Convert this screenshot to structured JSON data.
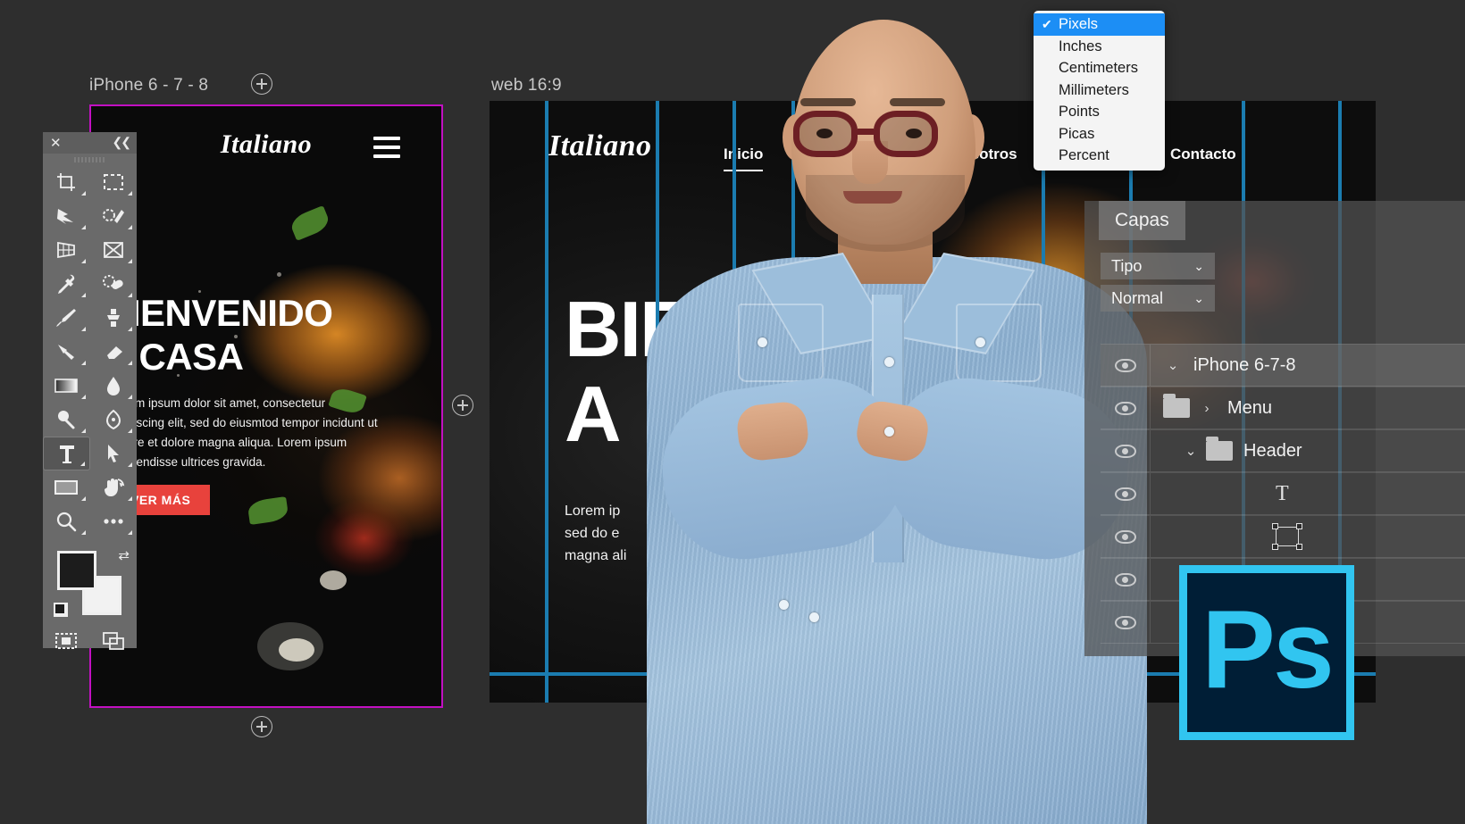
{
  "app": {
    "name": "Adobe Photoshop",
    "logo_text": "Ps",
    "accent_cyan": "#31C5F0",
    "logo_bg": "#001E36"
  },
  "canvas": {
    "background_color": "#2E2E2E",
    "artboards": [
      {
        "label": "iPhone 6 - 7 - 8",
        "border_color": "#C210C2",
        "design": {
          "logo": "Italiano",
          "menu_icon": "hamburger-icon",
          "heading_line1": "BIENVENIDO",
          "heading_line2": "A CASA",
          "body": "Lorem ipsum dolor sit amet, consectetur adipiscing elit, sed do eiusmtod tempor incidunt ut labore et dolore magna aliqua. Lorem ipsum suspendisse ultrices gravida.",
          "cta_label": "VER MÁS",
          "cta_color": "#E8423C"
        }
      },
      {
        "label": "web 16:9",
        "guide_color": "#1B7CB0",
        "design": {
          "logo": "Italiano",
          "nav": [
            {
              "label": "Inicio",
              "active": true
            },
            {
              "label": "Nosotros",
              "active": false
            },
            {
              "label": "Contacto",
              "active": false
            }
          ],
          "heading_line1": "BIE",
          "heading_line2": "A",
          "body_line1": "Lorem ip",
          "body_line2": "sed do e",
          "body_line3": "magna ali"
        }
      }
    ],
    "add_artboard_label": "+"
  },
  "units_dropdown": {
    "items": [
      {
        "label": "Pixels",
        "selected": true
      },
      {
        "label": "Inches",
        "selected": false
      },
      {
        "label": "Centimeters",
        "selected": false
      },
      {
        "label": "Millimeters",
        "selected": false
      },
      {
        "label": "Points",
        "selected": false
      },
      {
        "label": "Picas",
        "selected": false
      },
      {
        "label": "Percent",
        "selected": false
      }
    ],
    "check_glyph": "✔",
    "highlight_color": "#1C8EF5"
  },
  "layers_panel": {
    "tab_label": "Capas",
    "filter_type": "Tipo",
    "blend_mode": "Normal",
    "chevron_glyph": "⌄",
    "rows": [
      {
        "name": "iPhone 6-7-8",
        "kind": "group",
        "expanded": true,
        "visible": true,
        "selected": true,
        "disclosure": "⌄",
        "indent": 0
      },
      {
        "name": "Menu",
        "kind": "folder",
        "expanded": false,
        "visible": true,
        "selected": false,
        "disclosure": "›",
        "indent": 1
      },
      {
        "name": "Header",
        "kind": "folder",
        "expanded": true,
        "visible": true,
        "selected": false,
        "disclosure": "⌄",
        "indent": 2
      },
      {
        "name": "",
        "kind": "text",
        "expanded": false,
        "visible": true,
        "selected": false,
        "disclosure": "",
        "indent": 3
      },
      {
        "name": "",
        "kind": "shape",
        "expanded": false,
        "visible": true,
        "selected": false,
        "disclosure": "",
        "indent": 3
      },
      {
        "name": "",
        "kind": "layer",
        "expanded": false,
        "visible": true,
        "selected": false,
        "disclosure": "",
        "indent": 3
      },
      {
        "name": "",
        "kind": "folder",
        "expanded": false,
        "visible": true,
        "selected": false,
        "disclosure": "›",
        "indent": 1
      }
    ],
    "text_layer_glyph": "T"
  },
  "toolbar": {
    "close_glyph": "✕",
    "collapse_glyph": "❮❮",
    "tools": [
      {
        "name": "crop-tool",
        "glyph": "⌗",
        "active": false
      },
      {
        "name": "marquee-tool",
        "glyph": "▢",
        "active": false
      },
      {
        "name": "lasso-tool",
        "glyph": "✦",
        "active": false
      },
      {
        "name": "quick-selection-tool",
        "glyph": "✎",
        "active": false
      },
      {
        "name": "perspective-crop-tool",
        "glyph": "▦",
        "active": false
      },
      {
        "name": "slice-tool",
        "glyph": "⊠",
        "active": false
      },
      {
        "name": "eyedropper-tool",
        "glyph": "⚲",
        "active": false
      },
      {
        "name": "healing-brush-tool",
        "glyph": "✚",
        "active": false
      },
      {
        "name": "brush-tool",
        "glyph": "✏",
        "active": false
      },
      {
        "name": "clone-stamp-tool",
        "glyph": "⬒",
        "active": false
      },
      {
        "name": "history-brush-tool",
        "glyph": "↩",
        "active": false
      },
      {
        "name": "eraser-tool",
        "glyph": "▱",
        "active": false
      },
      {
        "name": "gradient-tool",
        "glyph": "▬",
        "active": false
      },
      {
        "name": "blur-tool",
        "glyph": "💧",
        "active": false
      },
      {
        "name": "dodge-tool",
        "glyph": "○",
        "active": false
      },
      {
        "name": "pen-tool",
        "glyph": "✒",
        "active": false
      },
      {
        "name": "type-tool",
        "glyph": "T",
        "active": true
      },
      {
        "name": "path-selection-tool",
        "glyph": "➤",
        "active": false
      },
      {
        "name": "rectangle-tool",
        "glyph": "▭",
        "active": false
      },
      {
        "name": "hand-tool",
        "glyph": "✋",
        "active": false
      },
      {
        "name": "zoom-tool",
        "glyph": "🔍",
        "active": false
      },
      {
        "name": "edit-toolbar-tool",
        "glyph": "•••",
        "active": false
      }
    ],
    "foreground_color": "#1C1C1C",
    "background_color": "#F2F2F2",
    "swap_glyph": "⇄",
    "quick_mask_glyph": "▣",
    "screen_mode_glyph": "❐"
  }
}
